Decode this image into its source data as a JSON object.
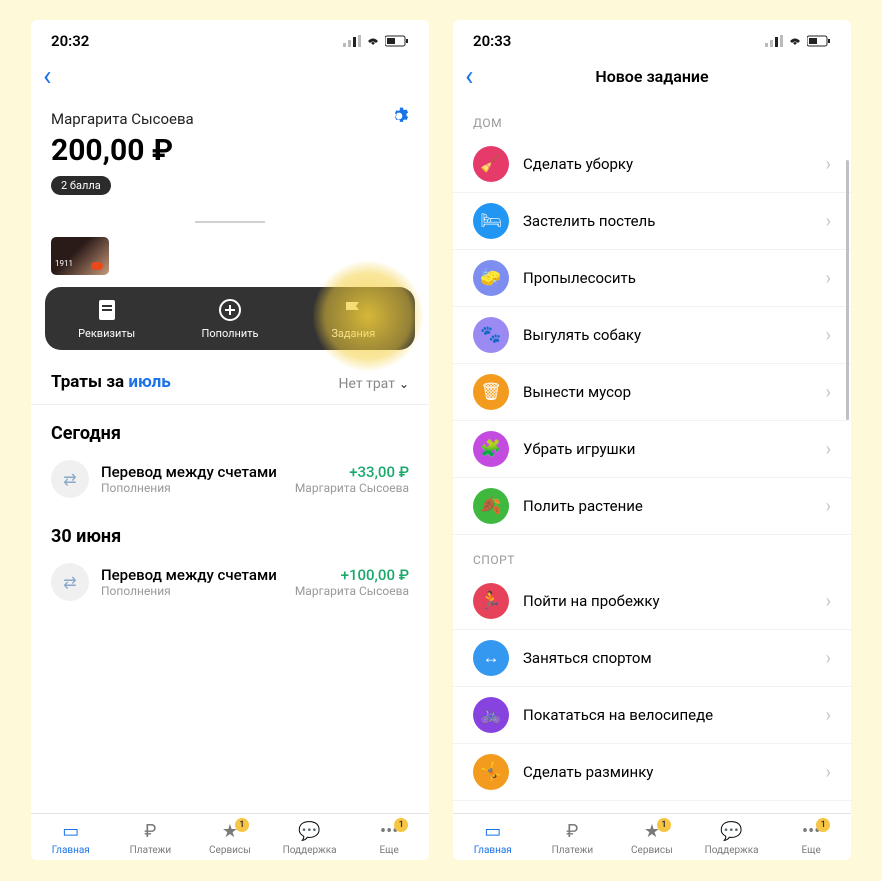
{
  "left": {
    "status": {
      "time": "20:32"
    },
    "user": {
      "name": "Маргарита Сысоева",
      "balance": "200,00 ₽",
      "points_badge": "2 балла"
    },
    "card": {
      "last4": "1911"
    },
    "actions": {
      "details": "Реквизиты",
      "topup": "Пополнить",
      "tasks": "Задания"
    },
    "spending": {
      "prefix": "Траты за ",
      "month": "июль",
      "value": "Нет трат"
    },
    "today_label": "Сегодня",
    "tx1": {
      "title": "Перевод между счетами",
      "sub": "Пополнения",
      "amount": "+33,00 ₽",
      "from": "Маргарита Сысоева"
    },
    "date2": "30 июня",
    "tx2": {
      "title": "Перевод между счетами",
      "sub": "Пополнения",
      "amount": "+100,00 ₽",
      "from": "Маргарита Сысоева"
    }
  },
  "right": {
    "status": {
      "time": "20:33"
    },
    "title": "Новое задание",
    "section_home": "ДОМ",
    "section_sport": "СПОРТ",
    "tasks_home": [
      {
        "label": "Сделать уборку",
        "color": "#e63a6a"
      },
      {
        "label": "Застелить постель",
        "color": "#2196f3"
      },
      {
        "label": "Пропылесосить",
        "color": "#7e8ef0"
      },
      {
        "label": "Выгулять собаку",
        "color": "#9b8af2"
      },
      {
        "label": "Вынести мусор",
        "color": "#f29b1f"
      },
      {
        "label": "Убрать игрушки",
        "color": "#c44be0"
      },
      {
        "label": "Полить растение",
        "color": "#3fb83f"
      }
    ],
    "tasks_sport": [
      {
        "label": "Пойти на пробежку",
        "color": "#e6435a"
      },
      {
        "label": "Заняться спортом",
        "color": "#3598f0"
      },
      {
        "label": "Покататься на велосипеде",
        "color": "#8743e0"
      },
      {
        "label": "Сделать разминку",
        "color": "#f29b1f"
      }
    ]
  },
  "tabbar": {
    "main": "Главная",
    "payments": "Платежи",
    "services": "Сервисы",
    "support": "Поддержка",
    "more": "Еще",
    "badge": "1"
  },
  "icons_home": [
    "🧹",
    "🛏",
    "🧽",
    "🐾",
    "🗑",
    "🧩",
    "🍂"
  ],
  "icons_sport": [
    "🏃",
    "↔",
    "🚲",
    "🤸"
  ]
}
